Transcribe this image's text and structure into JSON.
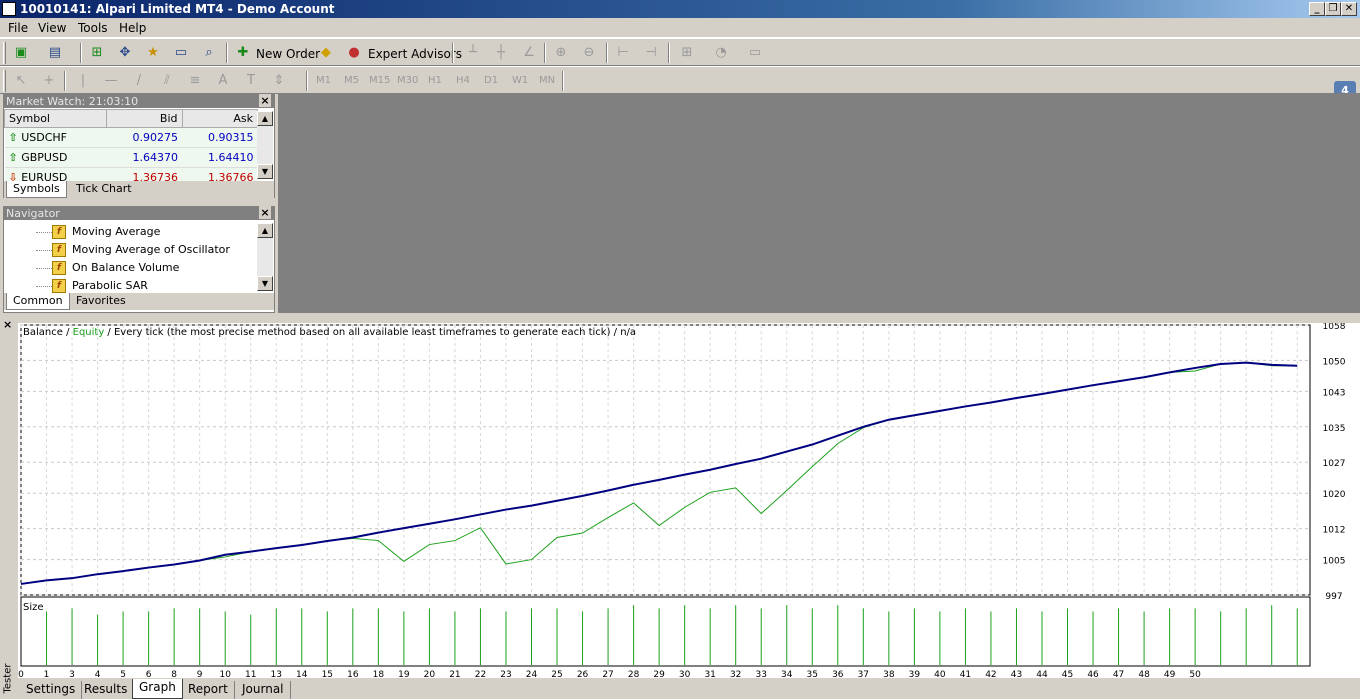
{
  "window": {
    "title": "10010141: Alpari Limited MT4 - Demo Account",
    "badge": "4"
  },
  "menu": [
    "File",
    "View",
    "Tools",
    "Help"
  ],
  "toolbar": {
    "new_order": "New Order",
    "expert_advisors": "Expert Advisors"
  },
  "timeframes": [
    "M1",
    "M5",
    "M15",
    "M30",
    "H1",
    "H4",
    "D1",
    "W1",
    "MN"
  ],
  "market_watch": {
    "title": "Market Watch: 21:03:10",
    "columns": [
      "Symbol",
      "Bid",
      "Ask"
    ],
    "rows": [
      {
        "symbol": "USDCHF",
        "bid": "0.90275",
        "ask": "0.90315",
        "dir": "up"
      },
      {
        "symbol": "GBPUSD",
        "bid": "1.64370",
        "ask": "1.64410",
        "dir": "up"
      },
      {
        "symbol": "EURUSD",
        "bid": "1.36736",
        "ask": "1.36766",
        "dir": "down"
      }
    ],
    "tabs": [
      "Symbols",
      "Tick Chart"
    ]
  },
  "navigator": {
    "title": "Navigator",
    "items": [
      "Moving Average",
      "Moving Average of Oscillator",
      "On Balance Volume",
      "Parabolic SAR"
    ],
    "tabs": [
      "Common",
      "Favorites"
    ]
  },
  "tester": {
    "side_label": "Tester",
    "tabs": [
      "Settings",
      "Results",
      "Graph",
      "Report",
      "Journal"
    ],
    "active_tab": "Graph"
  },
  "chart_data": {
    "type": "line",
    "title_parts": {
      "balance": "Balance",
      "sep1": " / ",
      "equity": "Equity",
      "rest": " / Every tick (the most precise method based on all available least timeframes to generate each tick) / n/a"
    },
    "colors": {
      "balance": "#000080",
      "equity": "#1aa01a",
      "size": "#1aa01a"
    },
    "y_ticks": [
      997,
      1005,
      1012,
      1020,
      1027,
      1035,
      1043,
      1050,
      1058
    ],
    "ylim": [
      997,
      1058
    ],
    "xlim": [
      0,
      50.5
    ],
    "x_ticks": [
      0,
      1,
      3,
      4,
      5,
      6,
      8,
      9,
      10,
      11,
      13,
      14,
      15,
      16,
      18,
      19,
      20,
      21,
      23,
      24,
      25,
      26,
      28,
      29,
      30,
      31,
      33,
      34,
      35,
      36,
      37,
      38,
      39,
      40,
      41,
      42,
      43,
      44,
      45,
      46,
      47,
      48,
      49,
      50
    ],
    "x_tick_pos": [
      0,
      1,
      2,
      3,
      4,
      5,
      6,
      7,
      8,
      9,
      10,
      11,
      12,
      13,
      14,
      15,
      16,
      17,
      18,
      19,
      20,
      21,
      22,
      23,
      24,
      25,
      26,
      27,
      28,
      29,
      30,
      31,
      32,
      33,
      34,
      35,
      36,
      37,
      38,
      39,
      40,
      41,
      42,
      43,
      44,
      45,
      46,
      47,
      48,
      49,
      50
    ],
    "x_tick_labels": [
      "0",
      "1",
      "3",
      "4",
      "5",
      "6",
      "8",
      "9",
      "10",
      "11",
      "13",
      "14",
      "15",
      "16",
      "18",
      "19",
      "20",
      "21",
      "22",
      "23",
      "24",
      "25",
      "26",
      "27",
      "28",
      "29",
      "30",
      "31",
      "32",
      "33",
      "34",
      "35",
      "36",
      "37",
      "38",
      "39",
      "40",
      "41",
      "42",
      "43",
      "44",
      "45",
      "46",
      "47",
      "48",
      "49",
      "50"
    ],
    "series": [
      {
        "name": "Balance",
        "x": [
          0,
          1,
          2,
          3,
          4,
          5,
          6,
          7,
          8,
          9,
          10,
          11,
          12,
          13,
          14,
          15,
          16,
          17,
          18,
          19,
          20,
          21,
          22,
          23,
          24,
          25,
          26,
          27,
          28,
          29,
          30,
          31,
          32,
          33,
          34,
          35,
          36,
          37,
          38,
          39,
          40,
          41,
          42,
          43,
          44,
          45,
          46,
          47,
          48,
          49,
          50
        ],
        "values": [
          999.5,
          1000.3,
          1000.8,
          1001.7,
          1002.4,
          1003.2,
          1003.9,
          1004.8,
          1006.1,
          1006.8,
          1007.6,
          1008.3,
          1009.2,
          1010.0,
          1011.1,
          1012.1,
          1013.1,
          1014.1,
          1015.2,
          1016.3,
          1017.2,
          1018.3,
          1019.4,
          1020.6,
          1021.9,
          1023.0,
          1024.2,
          1025.3,
          1026.6,
          1027.8,
          1029.4,
          1031.0,
          1033.0,
          1035.0,
          1036.6,
          1037.6,
          1038.6,
          1039.6,
          1040.5,
          1041.5,
          1042.4,
          1043.4,
          1044.4,
          1045.3,
          1046.2,
          1047.3,
          1048.3,
          1049.2,
          1049.5,
          1049.0,
          1048.8
        ]
      },
      {
        "name": "Equity",
        "x": [
          0,
          1,
          2,
          3,
          4,
          5,
          6,
          7,
          8,
          9,
          10,
          11,
          12,
          13,
          14,
          15,
          16,
          17,
          18,
          19,
          20,
          21,
          22,
          23,
          24,
          25,
          26,
          27,
          28,
          29,
          30,
          31,
          32,
          33,
          34,
          35,
          36,
          37,
          38,
          39,
          40,
          41,
          42,
          43,
          44,
          45,
          46,
          47,
          48,
          49,
          50
        ],
        "values": [
          999.5,
          1000.3,
          1000.8,
          1001.7,
          1002.4,
          1003.2,
          1003.9,
          1004.8,
          1005.6,
          1006.8,
          1007.6,
          1008.3,
          1009.2,
          1009.8,
          1009.3,
          1004.6,
          1008.4,
          1009.3,
          1012.2,
          1004.0,
          1005.0,
          1010.0,
          1011.0,
          1014.5,
          1017.8,
          1012.7,
          1016.8,
          1020.2,
          1021.2,
          1015.4,
          1020.6,
          1026.0,
          1031.2,
          1034.8,
          1036.6,
          1037.6,
          1038.6,
          1039.6,
          1040.5,
          1041.5,
          1042.4,
          1043.4,
          1044.4,
          1045.3,
          1046.2,
          1047.3,
          1047.6,
          1049.2,
          1049.5,
          1048.8,
          1048.8
        ]
      }
    ],
    "size_panel": {
      "label": "Size",
      "bars_x": [
        1,
        2,
        3,
        4,
        5,
        6,
        7,
        8,
        9,
        10,
        11,
        12,
        13,
        14,
        15,
        16,
        17,
        18,
        19,
        20,
        21,
        22,
        23,
        24,
        25,
        26,
        27,
        28,
        29,
        30,
        31,
        32,
        33,
        34,
        35,
        36,
        37,
        38,
        39,
        40,
        41,
        42,
        43,
        44,
        45,
        46,
        47,
        48,
        49,
        50
      ],
      "bars": [
        0.85,
        0.9,
        0.8,
        0.85,
        0.85,
        0.9,
        0.9,
        0.85,
        0.8,
        0.9,
        0.9,
        0.85,
        0.9,
        0.9,
        0.85,
        0.9,
        0.85,
        0.9,
        0.85,
        0.9,
        0.9,
        0.85,
        0.9,
        0.95,
        0.9,
        0.95,
        0.9,
        0.95,
        0.9,
        0.95,
        0.9,
        0.95,
        0.9,
        0.85,
        0.9,
        0.85,
        0.9,
        0.85,
        0.9,
        0.85,
        0.9,
        0.85,
        0.9,
        0.85,
        0.9,
        0.9,
        0.85,
        0.9,
        0.95,
        0.9
      ]
    }
  }
}
